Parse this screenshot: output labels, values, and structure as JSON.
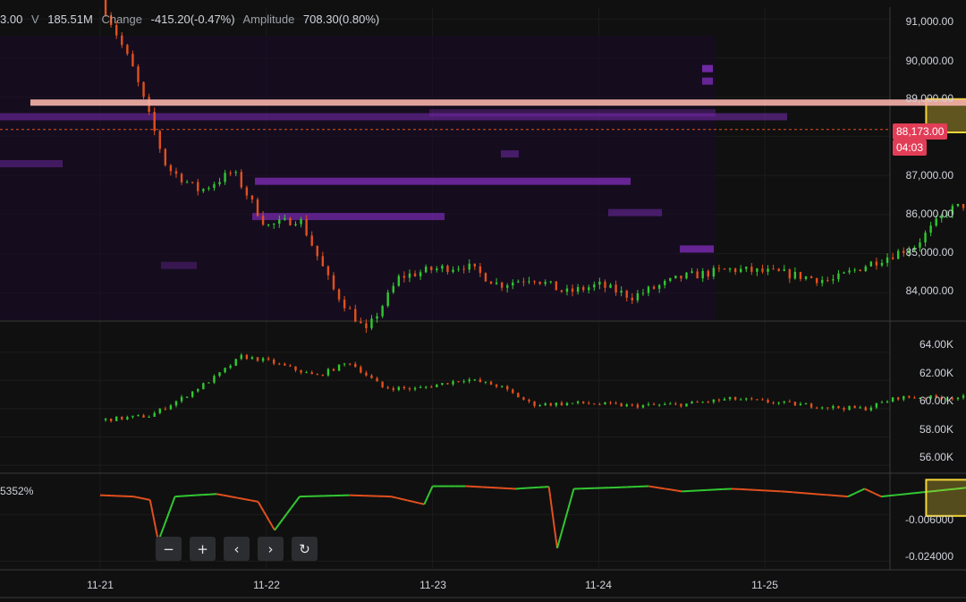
{
  "header": {
    "open_fragment": "3.00",
    "volume_key": "V",
    "volume_value": "185.51M",
    "change_key": "Change",
    "change_value": "-415.20(-0.47%)",
    "amplitude_key": "Amplitude",
    "amplitude_value": "708.30(0.80%)"
  },
  "current_price": {
    "label": "88,173.00",
    "countdown": "04:03",
    "color": "#e23d57"
  },
  "oscillator_label": "5352%",
  "nav_buttons": {
    "zoom_out": "−",
    "zoom_in": "+",
    "prev": "‹",
    "next": "›",
    "reset": "↻"
  },
  "colors": {
    "up": "#32c832",
    "down": "#e2501e",
    "highlight": "#f5d63a",
    "heatmap": "#7a2bb3",
    "background": "#101010"
  },
  "chart_data": [
    {
      "type": "candlestick",
      "title": "",
      "x_ticks": [
        "11-21",
        "11-22",
        "11-23",
        "11-24",
        "11-25"
      ],
      "y_ticks": [
        "91,000.00",
        "90,000.00",
        "89,000.00",
        "88,000.00",
        "87,000.00",
        "86,000.00",
        "85,000.00",
        "84,000.00"
      ],
      "ylim": [
        83300,
        91300
      ],
      "last_price": 88173,
      "resistance_line": 88850,
      "highlight_zone": [
        88100,
        88950
      ],
      "series": [
        {
          "close_path": [
            [
              0,
              91500
            ],
            [
              0.2,
              89700
            ],
            [
              0.4,
              87200
            ],
            [
              0.6,
              86600
            ],
            [
              0.8,
              87100
            ],
            [
              1.0,
              85700
            ],
            [
              1.2,
              85900
            ],
            [
              1.4,
              84100
            ],
            [
              1.6,
              83000
            ],
            [
              1.8,
              84400
            ],
            [
              2.0,
              84600
            ],
            [
              2.2,
              84700
            ],
            [
              2.4,
              84200
            ],
            [
              2.6,
              84400
            ],
            [
              2.8,
              84000
            ],
            [
              3.0,
              84200
            ],
            [
              3.2,
              83900
            ],
            [
              3.5,
              84400
            ],
            [
              3.8,
              84600
            ],
            [
              4.1,
              84500
            ],
            [
              4.4,
              84300
            ],
            [
              4.6,
              84700
            ],
            [
              4.9,
              85200
            ],
            [
              5.1,
              86100
            ],
            [
              5.3,
              86400
            ],
            [
              5.5,
              85800
            ],
            [
              5.7,
              86200
            ],
            [
              5.9,
              86100
            ],
            [
              6.1,
              86700
            ],
            [
              6.3,
              86900
            ],
            [
              6.5,
              87200
            ],
            [
              6.8,
              87400
            ],
            [
              7.0,
              87500
            ],
            [
              7.1,
              87900
            ],
            [
              7.2,
              87600
            ],
            [
              7.35,
              87300
            ],
            [
              7.55,
              87100
            ],
            [
              7.7,
              87500
            ],
            [
              7.9,
              87100
            ],
            [
              8.1,
              87200
            ],
            [
              8.3,
              86900
            ],
            [
              8.5,
              86300
            ],
            [
              8.7,
              85900
            ],
            [
              8.9,
              86000
            ],
            [
              9.1,
              86100
            ],
            [
              9.25,
              85800
            ],
            [
              9.4,
              86400
            ],
            [
              9.55,
              87000
            ],
            [
              9.7,
              88300
            ],
            [
              9.8,
              88500
            ]
          ]
        }
      ]
    },
    {
      "type": "candlestick",
      "title": "",
      "y_ticks": [
        "64.00K",
        "62.00K",
        "60.00K",
        "58.00K",
        "56.00K"
      ],
      "ylim": [
        55500,
        65500
      ],
      "series": [
        {
          "close_path": [
            [
              0,
              59200
            ],
            [
              0.3,
              59500
            ],
            [
              0.5,
              60800
            ],
            [
              0.7,
              62300
            ],
            [
              0.85,
              63700
            ],
            [
              1.0,
              63400
            ],
            [
              1.3,
              62300
            ],
            [
              1.5,
              63300
            ],
            [
              1.7,
              61500
            ],
            [
              1.9,
              61400
            ],
            [
              2.2,
              62100
            ],
            [
              2.4,
              61600
            ],
            [
              2.6,
              60300
            ],
            [
              2.9,
              60400
            ],
            [
              3.2,
              60200
            ],
            [
              3.5,
              60300
            ],
            [
              3.8,
              60700
            ],
            [
              4.1,
              60400
            ],
            [
              4.4,
              60100
            ],
            [
              4.6,
              60000
            ],
            [
              4.8,
              60800
            ],
            [
              5.0,
              60800
            ],
            [
              5.2,
              60800
            ],
            [
              5.4,
              60300
            ],
            [
              5.7,
              60600
            ],
            [
              5.9,
              60700
            ],
            [
              6.1,
              61500
            ],
            [
              6.3,
              61500
            ],
            [
              6.5,
              62000
            ],
            [
              6.7,
              62000
            ],
            [
              6.9,
              61300
            ],
            [
              7.0,
              60700
            ],
            [
              7.2,
              60600
            ],
            [
              7.4,
              60700
            ],
            [
              7.6,
              60700
            ],
            [
              7.8,
              60600
            ],
            [
              8.0,
              60700
            ],
            [
              8.2,
              60600
            ],
            [
              8.4,
              60800
            ],
            [
              8.6,
              60700
            ],
            [
              8.8,
              60800
            ],
            [
              9.0,
              60300
            ],
            [
              9.2,
              60500
            ],
            [
              9.4,
              60900
            ],
            [
              9.5,
              60200
            ],
            [
              9.7,
              60600
            ],
            [
              9.8,
              59900
            ]
          ]
        }
      ]
    },
    {
      "type": "line",
      "title": "",
      "y_ticks": [
        "-0.006000",
        "-0.024000"
      ],
      "ylim": [
        -0.027,
        0.009
      ],
      "series": [
        {
          "path": [
            [
              0,
              0.0015
            ],
            [
              0.2,
              0.001
            ],
            [
              0.3,
              -0.0003
            ],
            [
              0.35,
              -0.0163
            ],
            [
              0.45,
              0.001
            ],
            [
              0.7,
              0.002
            ],
            [
              0.95,
              -0.001
            ],
            [
              1.05,
              -0.012
            ],
            [
              1.2,
              0.001
            ],
            [
              1.5,
              0.0015
            ],
            [
              1.75,
              0.001
            ],
            [
              1.95,
              -0.002
            ],
            [
              2.0,
              0.005
            ],
            [
              2.2,
              0.005
            ],
            [
              2.5,
              0.004
            ],
            [
              2.7,
              0.0048
            ],
            [
              2.75,
              -0.019
            ],
            [
              2.85,
              0.004
            ],
            [
              3.1,
              0.0045
            ],
            [
              3.3,
              0.005
            ],
            [
              3.5,
              0.003
            ],
            [
              3.8,
              0.004
            ],
            [
              4.1,
              0.003
            ],
            [
              4.5,
              0.001
            ],
            [
              4.6,
              0.004
            ],
            [
              4.7,
              0.001
            ],
            [
              5.0,
              0.003
            ],
            [
              5.3,
              0.005
            ],
            [
              5.6,
              0.004
            ],
            [
              5.9,
              0.003
            ],
            [
              6.1,
              0.001
            ],
            [
              6.2,
              0.005
            ],
            [
              6.5,
              0.004
            ],
            [
              6.8,
              0.005
            ],
            [
              7.1,
              0.002
            ],
            [
              7.3,
              0.003
            ],
            [
              7.5,
              0.001
            ],
            [
              7.6,
              0.005
            ],
            [
              7.8,
              0.003
            ],
            [
              8.1,
              0.003
            ],
            [
              8.3,
              0.002
            ],
            [
              8.4,
              0.006
            ],
            [
              8.6,
              0.002
            ],
            [
              8.9,
              0.003
            ],
            [
              9.2,
              0.002
            ],
            [
              9.4,
              0.0015
            ],
            [
              9.55,
              0.004
            ],
            [
              9.7,
              0.002
            ],
            [
              9.8,
              0.001
            ]
          ]
        }
      ],
      "highlight_zone": [
        -0.0065,
        0.0075
      ]
    }
  ]
}
